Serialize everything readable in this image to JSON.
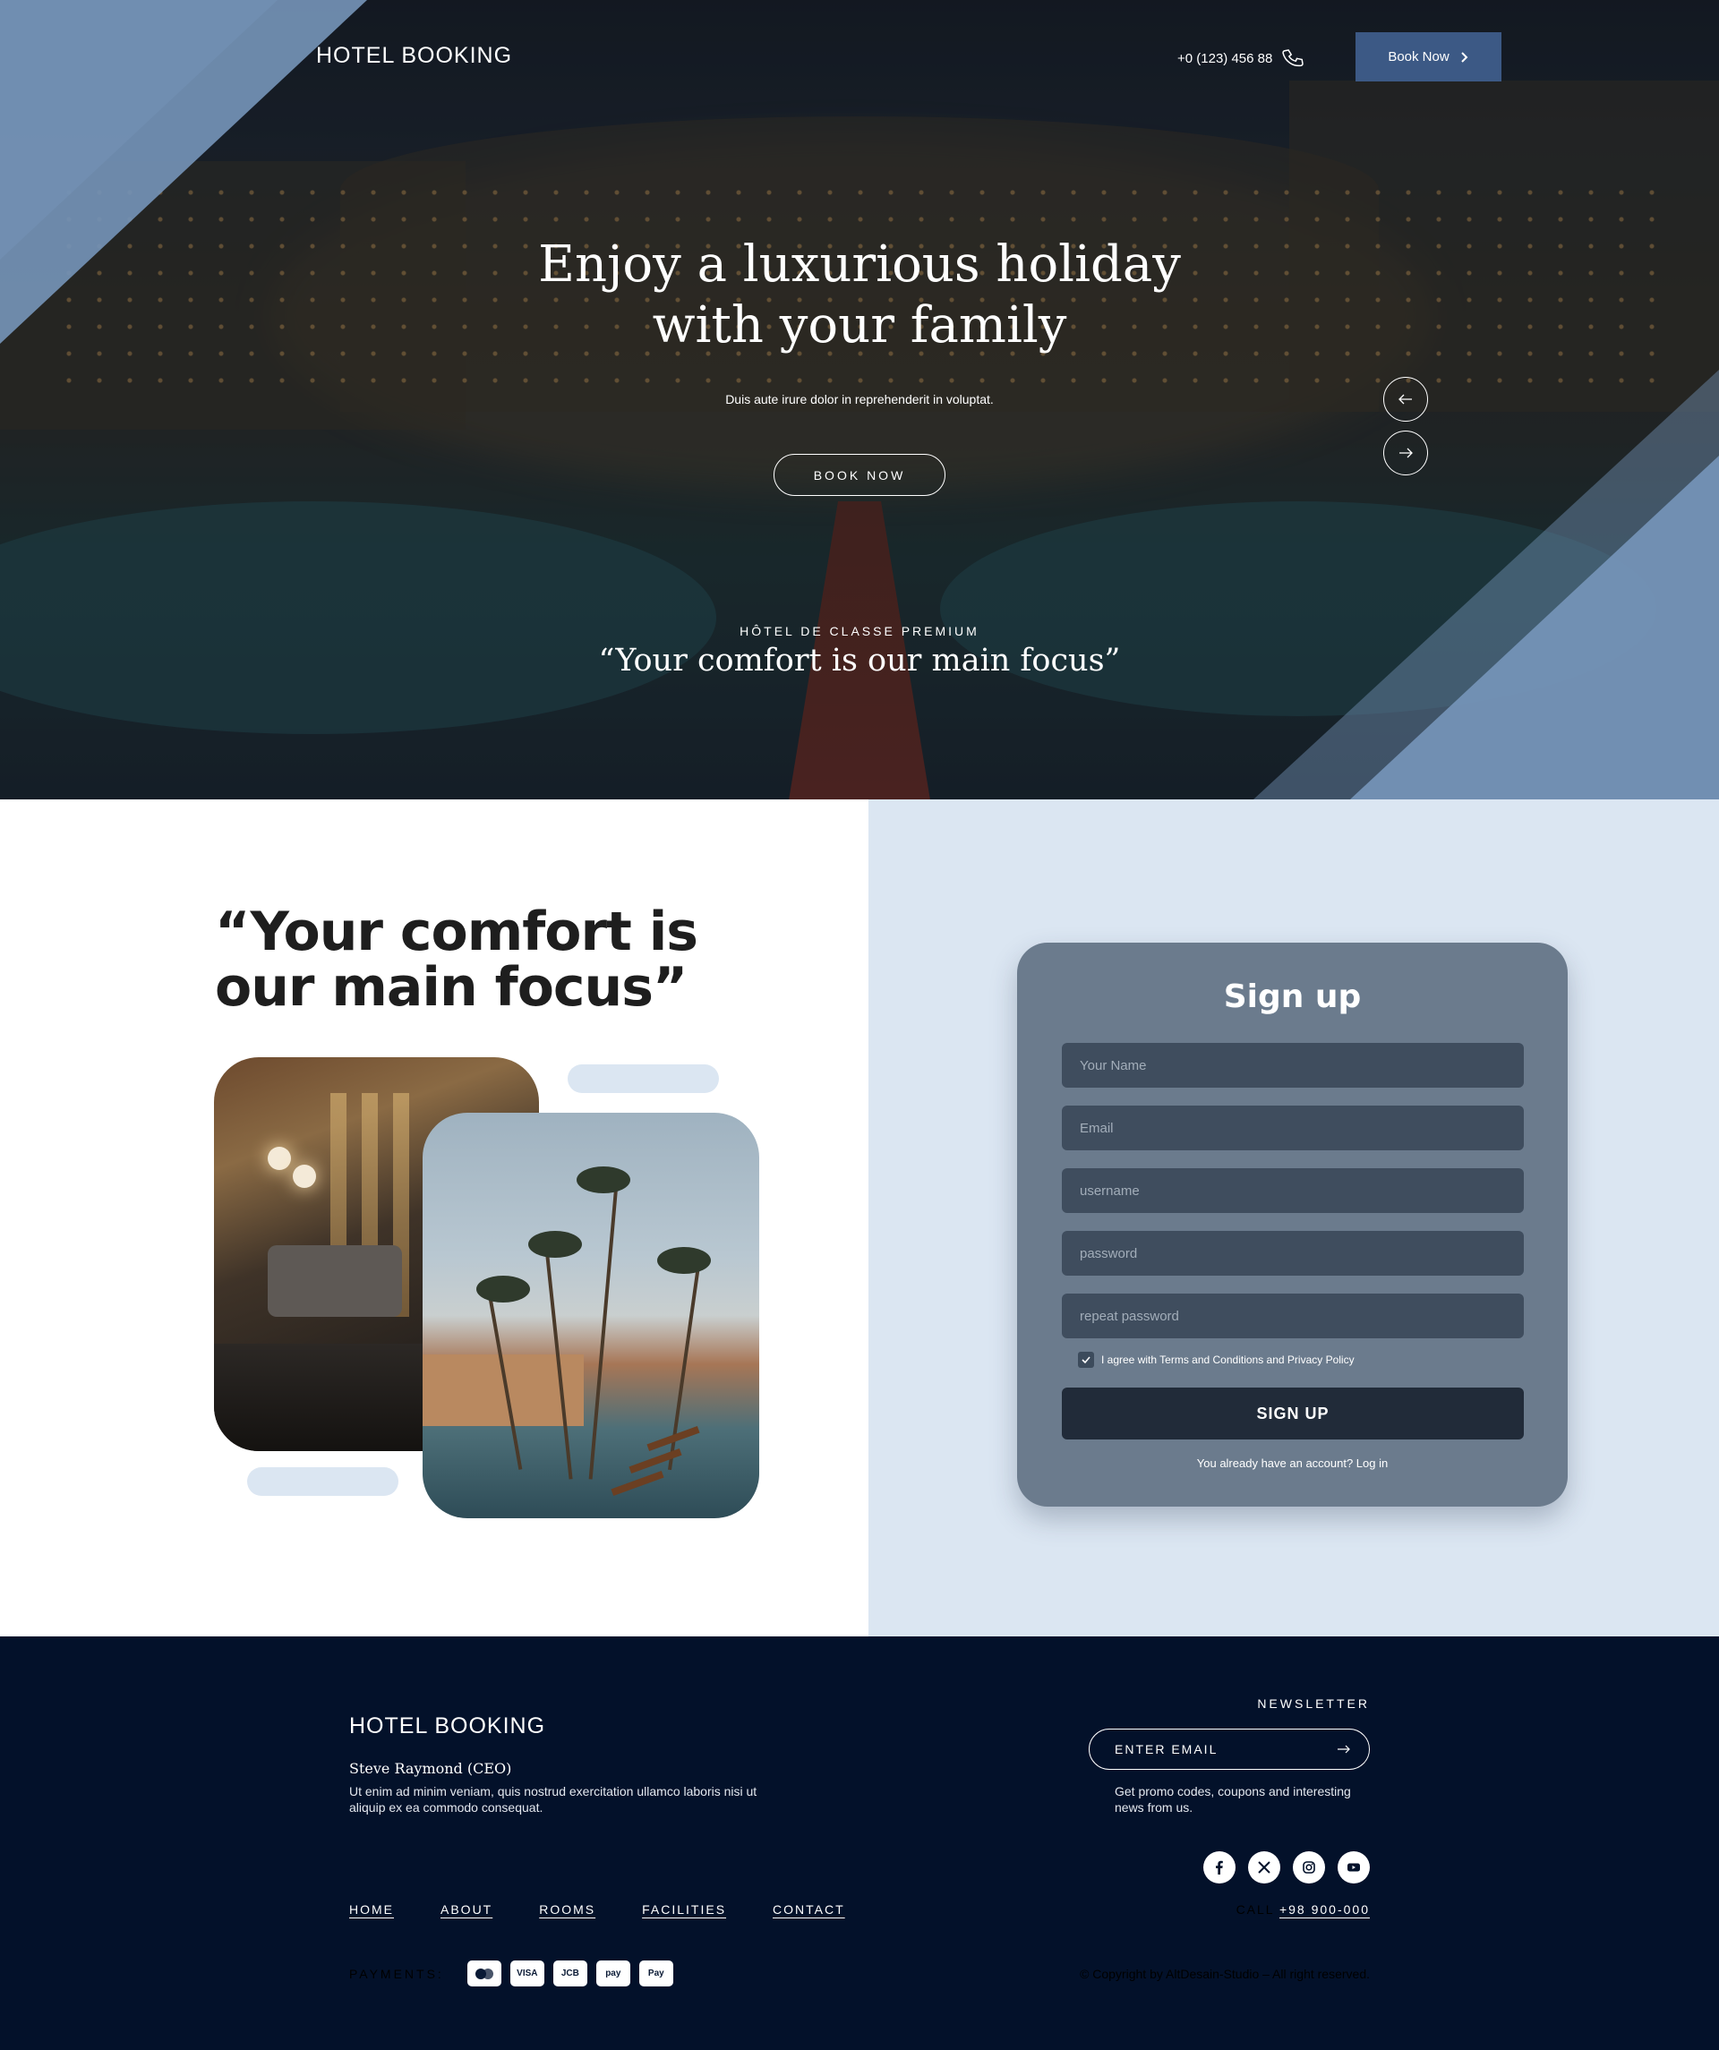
{
  "header": {
    "brand": "HOTEL BOOKING",
    "phone": "+0 (123) 456 88",
    "book_button": "Book Now"
  },
  "hero": {
    "title_line1": "Enjoy a luxurious holiday",
    "title_line2": "with your family",
    "subtitle": "Duis aute irure dolor in reprehenderit in voluptat.",
    "cta": "BOOK NOW",
    "kicker": "HÔTEL DE CLASSE PREMIUM",
    "quote": "“Your comfort is our main focus”"
  },
  "about": {
    "quote_line1": "“Your comfort is",
    "quote_line2": "our main focus”"
  },
  "signup": {
    "title": "Sign up",
    "name_placeholder": "Your Name",
    "email_placeholder": "Email",
    "username_placeholder": "username",
    "password_placeholder": "password",
    "repeat_placeholder": "repeat password",
    "agree_text": "I agree with Terms and Conditions and Privacy Policy",
    "agree_checked": true,
    "button": "SIGN UP",
    "login_text": "You already have an account? Log in"
  },
  "footer": {
    "brand": "HOTEL BOOKING",
    "ceo": "Steve Raymond (CEO)",
    "description": "Ut enim ad minim veniam, quis nostrud exercitation ullamco laboris nisi ut aliquip ex ea commodo consequat.",
    "newsletter_label": "NEWSLETTER",
    "email_placeholder": "ENTER EMAIL",
    "newsletter_note": "Get promo codes, coupons and interesting news from us.",
    "socials": [
      "facebook-icon",
      "x-icon",
      "instagram-icon",
      "youtube-icon"
    ],
    "nav": [
      "HOME",
      "ABOUT",
      "ROOMS",
      "FACILITIES",
      "CONTACT"
    ],
    "call_label": "CALL",
    "call_number": "+98 900-000",
    "payments_label": "PAYMENTS:",
    "payment_methods": [
      "mastercard-icon",
      "VISA",
      "JCB",
      "pay",
      "Pay"
    ],
    "copyright": "© Copyright by AltDesain-Studio – All right reserved."
  },
  "colors": {
    "accent": "#3c5985",
    "light_blue": "#dbe6f2",
    "card": "#6b7b8d",
    "footer": "#03112a"
  }
}
